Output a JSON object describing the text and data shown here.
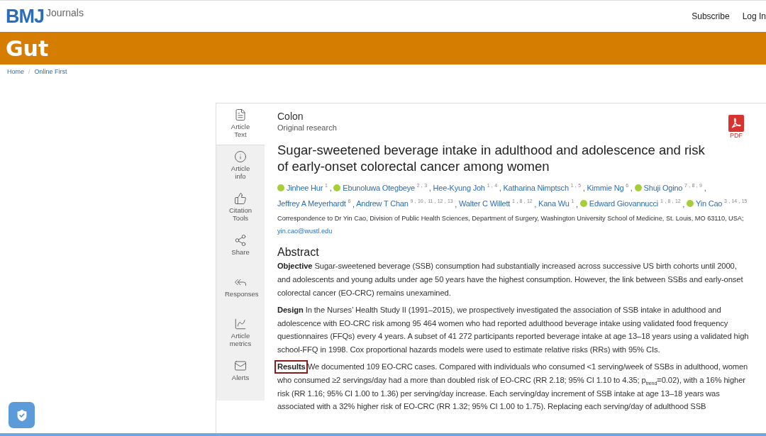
{
  "header": {
    "logo": "BMJ",
    "logo_suffix": "Journals",
    "links": [
      "Subscribe",
      "Log In"
    ]
  },
  "journal": {
    "title": "Gut"
  },
  "breadcrumb": [
    "Home",
    "Online First"
  ],
  "breadcrumb_separator": "/",
  "side_tabs": [
    {
      "label": "Article Text",
      "selected": true
    },
    {
      "label": "Article info",
      "selected": false
    },
    {
      "label": "Citation Tools",
      "selected": false
    },
    {
      "label": "Share",
      "selected": false
    },
    {
      "label": "Responses",
      "selected": false
    },
    {
      "label": "Article metrics",
      "selected": false
    },
    {
      "label": "Alerts",
      "selected": false
    }
  ],
  "article": {
    "section": "Colon",
    "type": "Original research",
    "pdf_label": "PDF",
    "title": "Sugar-sweetened beverage intake in adulthood and adolescence and risk of early-onset colorectal cancer among women",
    "authors": [
      {
        "name": "Jinhee Hur",
        "sup": "1",
        "orcid": true,
        "after": ","
      },
      {
        "name": "Ebunoluwa Otegbeye",
        "sup": "2，3",
        "orcid": true,
        "after": ","
      },
      {
        "name": "Hee-Kyung Joh",
        "sup": "1，4",
        "orcid": false,
        "after": ","
      },
      {
        "name": "Katharina Nimptsch",
        "sup": "1，5",
        "orcid": false,
        "after": ","
      },
      {
        "name": "Kimmie Ng",
        "sup": "6",
        "orcid": false,
        "after": ","
      },
      {
        "name": "Shuji Ogino",
        "sup": "7，8，9",
        "orcid": true,
        "after": ","
      },
      {
        "name": "Jeffrey A Meyerhardt",
        "sup": "6",
        "orcid": false,
        "after": ","
      },
      {
        "name": "Andrew T Chan",
        "sup": "9，10，11，12，13",
        "orcid": false,
        "after": ","
      },
      {
        "name": "Walter C Willett",
        "sup": "1，8，12",
        "orcid": false,
        "after": ","
      },
      {
        "name": "Kana Wu",
        "sup": "1",
        "orcid": false,
        "after": ","
      },
      {
        "name": "Edward Giovannucci",
        "sup": "1，8，12",
        "orcid": true,
        "after": ","
      },
      {
        "name": "Yin Cao",
        "sup": "3，14，15",
        "orcid": true
      }
    ],
    "correspondence": "Correspondence to Dr Yin Cao, Division of Public Health Sciences, Department of Surgery, Washington University School of Medicine, St. Louis, MO 63110, USA;",
    "email": "yin.cao@wustl.edu",
    "abstract_heading": "Abstract",
    "abstract": [
      {
        "label": "Objective",
        "text": "Sugar-sweetened beverage (SSB) consumption had substantially increased across successive US birth cohorts until 2000, and adolescents and young adults under age 50 years have the highest consumption. However, the link between SSBs and early-onset colorectal cancer (EO-CRC) remains unexamined.",
        "highlighted": false
      },
      {
        "label": "Design",
        "text": "In the Nurses’ Health Study II (1991–2015), we prospectively investigated the association of SSB intake in adulthood and adolescence with EO-CRC risk among 95 464 women who had reported adulthood beverage intake using validated food frequency questionnaires (FFQs) every 4 years. A subset of 41 272 participants reported beverage intake at age 13–18 years using a validated high school-FFQ in 1998. Cox proportional hazards models were used to estimate relative risks (RRs) with 95% CIs.",
        "highlighted": false
      },
      {
        "label": "Results",
        "text": "We documented 109 EO-CRC cases. Compared with individuals who consumed <1 serving/week of SSBs in adulthood, women who consumed ≥2 servings/day had a more than doubled risk of EO-CRC (RR 2.18; 95% CI 1.10 to 4.35; p$_{trend}$=0.02), with a 16% higher risk (RR 1.16; 95% CI 1.00 to 1.36) per serving/day increase. Each serving/day increment of SSB intake at age 13–18 years was associated with a 32% higher risk of EO-CRC (RR 1.32; 95% CI 1.00 to 1.75). Replacing each serving/day of adulthood SSB",
        "highlighted": true
      }
    ]
  }
}
